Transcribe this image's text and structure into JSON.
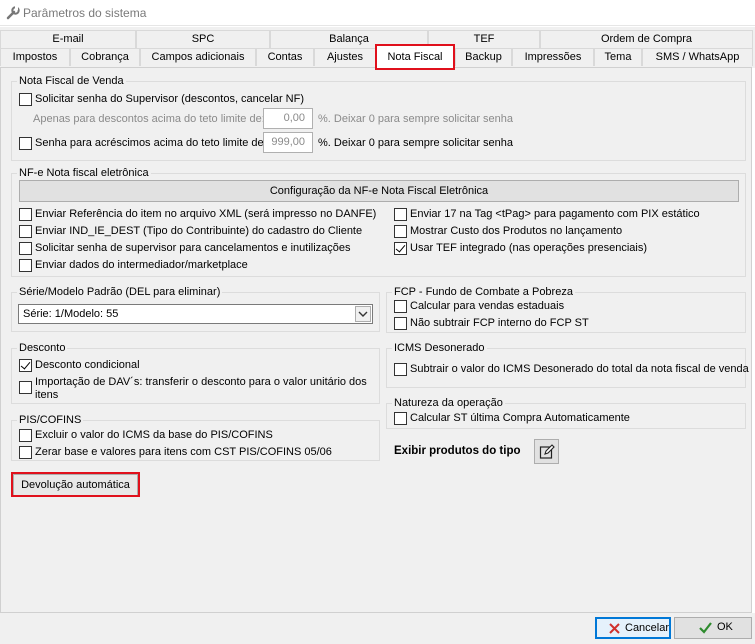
{
  "window": {
    "title": "Parâmetros do sistema",
    "icon": "wrench-icon"
  },
  "tabs_row1": [
    "E-mail",
    "SPC",
    "Balança",
    "TEF",
    "Ordem de Compra"
  ],
  "tabs_row2": [
    "Impostos",
    "Cobrança",
    "Campos adicionais",
    "Contas",
    "Ajustes",
    "Nota Fiscal",
    "Backup",
    "Impressões",
    "Tema",
    "SMS / WhatsApp"
  ],
  "active_tab": "Nota Fiscal",
  "nf_venda": {
    "legend": "Nota Fiscal de Venda",
    "senha_supervisor": "Solicitar senha do Supervisor (descontos, cancelar NF)",
    "apenas_label": "Apenas para descontos acima do teto limite de:",
    "apenas_value": "0,00",
    "apenas_suffix": "%. Deixar 0 para sempre solicitar senha",
    "acrescimos_label": "Senha para acréscimos acima do teto limite de:",
    "acrescimos_value": "999,00",
    "acrescimos_suffix": "%. Deixar 0 para sempre solicitar senha"
  },
  "nfe": {
    "legend": "NF-e Nota fiscal eletrônica",
    "config_button": "Configuração da NF-e Nota Fiscal Eletrônica",
    "left": [
      {
        "label": "Enviar Referência do item no arquivo XML (será impresso no DANFE)",
        "checked": false
      },
      {
        "label": "Enviar IND_IE_DEST (Tipo do Contribuinte) do cadastro do Cliente",
        "checked": false
      },
      {
        "label": "Solicitar senha de supervisor para cancelamentos e inutilizações",
        "checked": false
      },
      {
        "label": "Enviar dados do intermediador/marketplace",
        "checked": false
      }
    ],
    "right": [
      {
        "label": "Enviar 17 na Tag <tPag> para pagamento com PIX estático",
        "checked": false
      },
      {
        "label": "Mostrar Custo dos Produtos no lançamento",
        "checked": false
      },
      {
        "label": "Usar TEF integrado (nas operações presenciais)",
        "checked": true
      }
    ]
  },
  "serie": {
    "legend": "Série/Modelo Padrão (DEL para eliminar)",
    "selected": "Série: 1/Modelo: 55"
  },
  "fcp": {
    "legend": "FCP - Fundo de Combate a Pobreza",
    "items": [
      {
        "label": "Calcular para vendas estaduais",
        "checked": false
      },
      {
        "label": "Não subtrair FCP interno do FCP ST",
        "checked": false
      }
    ]
  },
  "desconto": {
    "legend": "Desconto",
    "items": [
      {
        "label": "Desconto condicional",
        "checked": true
      },
      {
        "label": "Importação de DAV´s: transferir o desconto para o valor unitário dos",
        "label2": "itens",
        "checked": false
      }
    ]
  },
  "icms": {
    "legend": "ICMS Desonerado",
    "item": {
      "label": "Subtrair o valor do ICMS Desonerado do total da nota fiscal de venda",
      "checked": false
    }
  },
  "pis": {
    "legend": "PIS/COFINS",
    "items": [
      {
        "label": "Excluir o valor do ICMS da base do PIS/COFINS",
        "checked": false
      },
      {
        "label": "Zerar base e valores para itens com CST PIS/COFINS 05/06",
        "checked": false
      }
    ]
  },
  "natureza": {
    "legend": "Natureza da operação",
    "item": {
      "label": "Calcular ST última Compra Automaticamente",
      "checked": false
    }
  },
  "exibir": {
    "label": "Exibir produtos do tipo",
    "icon": "edit-icon"
  },
  "devolucao_button": "Devolução automática",
  "footer": {
    "cancel": "Cancelar",
    "ok": "OK"
  },
  "colors": {
    "highlight": "#e0101c",
    "ok_check": "#2e8b2e",
    "cancel_x": "#d0312d"
  }
}
